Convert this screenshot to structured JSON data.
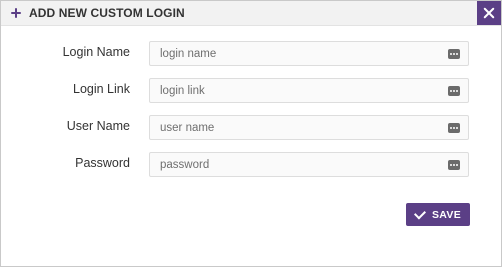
{
  "dialog": {
    "title": "ADD NEW CUSTOM LOGIN",
    "accent_color": "#5b3f86",
    "icons": {
      "title": "plus-icon",
      "close": "close-icon",
      "field": "dots-icon",
      "save": "check-icon"
    }
  },
  "form": {
    "fields": [
      {
        "label": "Login Name",
        "placeholder": "login name",
        "value": ""
      },
      {
        "label": "Login Link",
        "placeholder": "login link",
        "value": ""
      },
      {
        "label": "User Name",
        "placeholder": "user name",
        "value": ""
      },
      {
        "label": "Password",
        "placeholder": "password",
        "value": ""
      }
    ]
  },
  "actions": {
    "save_label": "SAVE"
  }
}
